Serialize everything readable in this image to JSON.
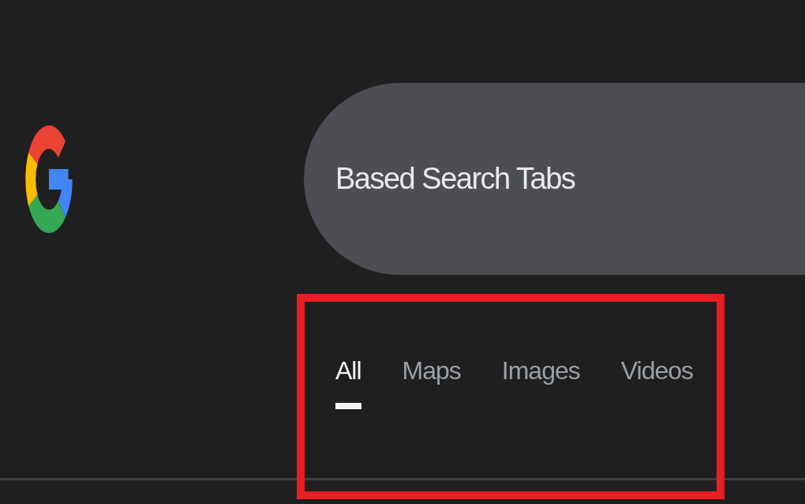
{
  "search": {
    "value": "Based Search Tabs"
  },
  "tabs": [
    {
      "label": "All",
      "selected": true
    },
    {
      "label": "Maps",
      "selected": false
    },
    {
      "label": "Images",
      "selected": false
    },
    {
      "label": "Videos",
      "selected": false
    }
  ]
}
